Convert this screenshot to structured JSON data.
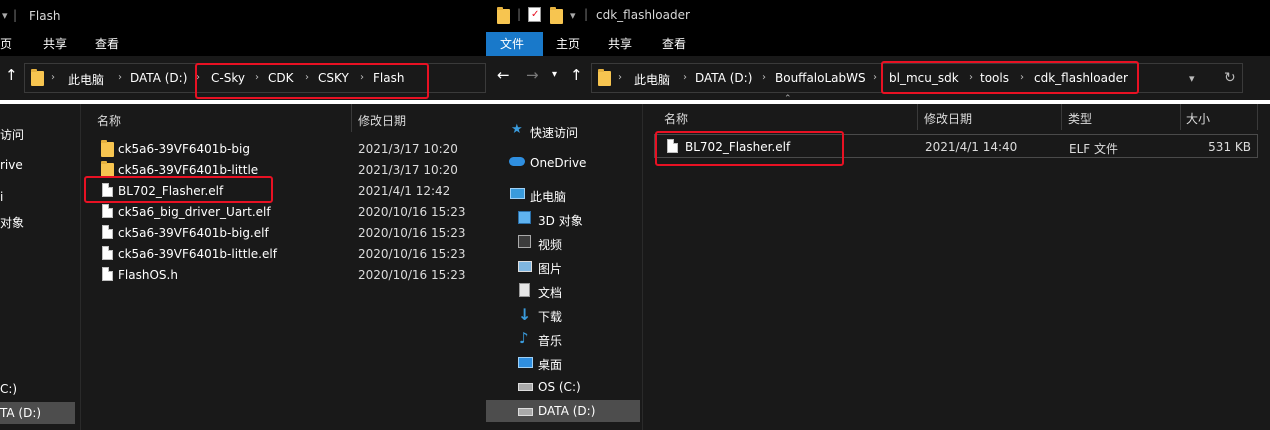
{
  "left": {
    "title": "Flash",
    "ribbon": {
      "tabs": [
        "页",
        "共享",
        "查看"
      ]
    },
    "address": {
      "crumbs": [
        "此电脑",
        "DATA (D:)",
        "C-Sky",
        "CDK",
        "CSKY",
        "Flash"
      ]
    },
    "columns": {
      "name": "名称",
      "date": "修改日期"
    },
    "files": [
      {
        "name": "ck5a6-39VF6401b-big",
        "date": "2021/3/17 10:20",
        "icon": "folder-icon"
      },
      {
        "name": "ck5a6-39VF6401b-little",
        "date": "2021/3/17 10:20",
        "icon": "folder-icon"
      },
      {
        "name": "BL702_Flasher.elf",
        "date": "2021/4/1 12:42",
        "icon": "file-icon"
      },
      {
        "name": "ck5a6_big_driver_Uart.elf",
        "date": "2020/10/16 15:23",
        "icon": "file-icon"
      },
      {
        "name": "ck5a6-39VF6401b-big.elf",
        "date": "2020/10/16 15:23",
        "icon": "file-icon"
      },
      {
        "name": "ck5a6-39VF6401b-little.elf",
        "date": "2020/10/16 15:23",
        "icon": "file-icon"
      },
      {
        "name": "FlashOS.h",
        "date": "2020/10/16 15:23",
        "icon": "file-icon"
      }
    ],
    "sidebar": {
      "items": [
        "访问",
        "rive",
        "i",
        "对象"
      ],
      "drives": [
        "C:)",
        "TA (D:)"
      ]
    }
  },
  "right": {
    "title": "cdk_flashloader",
    "ribbon": {
      "tabs": [
        "文件",
        "主页",
        "共享",
        "查看"
      ],
      "active": "文件"
    },
    "address": {
      "crumbs": [
        "此电脑",
        "DATA (D:)",
        "BouffaloLabWS",
        "bl_mcu_sdk",
        "tools",
        "cdk_flashloader"
      ]
    },
    "columns": {
      "name": "名称",
      "date": "修改日期",
      "type": "类型",
      "size": "大小"
    },
    "files": [
      {
        "name": "BL702_Flasher.elf",
        "date": "2021/4/1 14:40",
        "type": "ELF 文件",
        "size": "531 KB"
      }
    ],
    "sidebar": {
      "items": [
        {
          "label": "快速访问",
          "icon": "star-icon"
        },
        {
          "label": "OneDrive",
          "icon": "cloud-icon"
        },
        {
          "label": "此电脑",
          "icon": "computer-icon"
        },
        {
          "label": "3D 对象",
          "icon": "cube-icon"
        },
        {
          "label": "视频",
          "icon": "video-icon"
        },
        {
          "label": "图片",
          "icon": "picture-icon"
        },
        {
          "label": "文档",
          "icon": "document-icon"
        },
        {
          "label": "下载",
          "icon": "download-icon"
        },
        {
          "label": "音乐",
          "icon": "music-icon"
        },
        {
          "label": "桌面",
          "icon": "desktop-icon"
        },
        {
          "label": "OS (C:)",
          "icon": "drive-c-icon"
        },
        {
          "label": "DATA (D:)",
          "icon": "drive-d-icon",
          "selected": true
        }
      ]
    }
  },
  "colors": {
    "accent": "#1979ca",
    "highlight": "#e81123",
    "background": "#191919"
  }
}
